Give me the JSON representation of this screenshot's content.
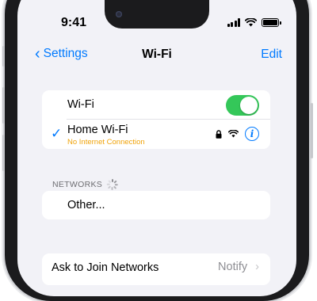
{
  "status_bar": {
    "time": "9:41"
  },
  "nav": {
    "back_label": "Settings",
    "title": "Wi-Fi",
    "edit_label": "Edit"
  },
  "wifi": {
    "label": "Wi-Fi",
    "enabled": true,
    "accent_color": "#34c759"
  },
  "current_network": {
    "name": "Home Wi-Fi",
    "status": "No Internet Connection",
    "status_color": "#f0a30a",
    "icons": [
      "checkmark-icon",
      "lock-icon",
      "wifi-signal-icon",
      "info-icon"
    ]
  },
  "networks_section": {
    "header": "NETWORKS"
  },
  "other": {
    "label": "Other..."
  },
  "ask_to_join": {
    "label": "Ask to Join Networks",
    "value": "Notify"
  },
  "colors": {
    "link": "#007aff",
    "background": "#f2f2f7"
  }
}
